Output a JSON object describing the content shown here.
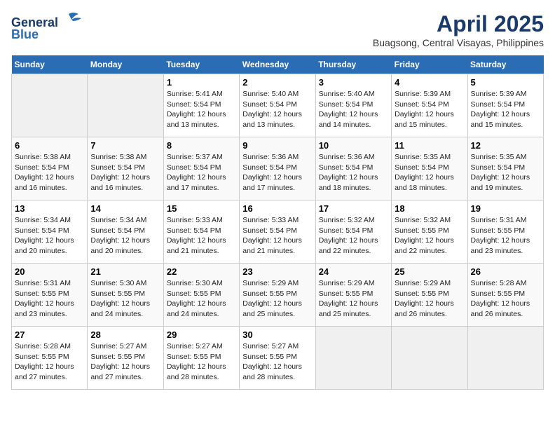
{
  "logo": {
    "line1": "General",
    "line2": "Blue"
  },
  "title": {
    "month_year": "April 2025",
    "location": "Buagsong, Central Visayas, Philippines"
  },
  "weekdays": [
    "Sunday",
    "Monday",
    "Tuesday",
    "Wednesday",
    "Thursday",
    "Friday",
    "Saturday"
  ],
  "weeks": [
    [
      {
        "day": "",
        "info": ""
      },
      {
        "day": "",
        "info": ""
      },
      {
        "day": "1",
        "info": "Sunrise: 5:41 AM\nSunset: 5:54 PM\nDaylight: 12 hours\nand 13 minutes."
      },
      {
        "day": "2",
        "info": "Sunrise: 5:40 AM\nSunset: 5:54 PM\nDaylight: 12 hours\nand 13 minutes."
      },
      {
        "day": "3",
        "info": "Sunrise: 5:40 AM\nSunset: 5:54 PM\nDaylight: 12 hours\nand 14 minutes."
      },
      {
        "day": "4",
        "info": "Sunrise: 5:39 AM\nSunset: 5:54 PM\nDaylight: 12 hours\nand 15 minutes."
      },
      {
        "day": "5",
        "info": "Sunrise: 5:39 AM\nSunset: 5:54 PM\nDaylight: 12 hours\nand 15 minutes."
      }
    ],
    [
      {
        "day": "6",
        "info": "Sunrise: 5:38 AM\nSunset: 5:54 PM\nDaylight: 12 hours\nand 16 minutes."
      },
      {
        "day": "7",
        "info": "Sunrise: 5:38 AM\nSunset: 5:54 PM\nDaylight: 12 hours\nand 16 minutes."
      },
      {
        "day": "8",
        "info": "Sunrise: 5:37 AM\nSunset: 5:54 PM\nDaylight: 12 hours\nand 17 minutes."
      },
      {
        "day": "9",
        "info": "Sunrise: 5:36 AM\nSunset: 5:54 PM\nDaylight: 12 hours\nand 17 minutes."
      },
      {
        "day": "10",
        "info": "Sunrise: 5:36 AM\nSunset: 5:54 PM\nDaylight: 12 hours\nand 18 minutes."
      },
      {
        "day": "11",
        "info": "Sunrise: 5:35 AM\nSunset: 5:54 PM\nDaylight: 12 hours\nand 18 minutes."
      },
      {
        "day": "12",
        "info": "Sunrise: 5:35 AM\nSunset: 5:54 PM\nDaylight: 12 hours\nand 19 minutes."
      }
    ],
    [
      {
        "day": "13",
        "info": "Sunrise: 5:34 AM\nSunset: 5:54 PM\nDaylight: 12 hours\nand 20 minutes."
      },
      {
        "day": "14",
        "info": "Sunrise: 5:34 AM\nSunset: 5:54 PM\nDaylight: 12 hours\nand 20 minutes."
      },
      {
        "day": "15",
        "info": "Sunrise: 5:33 AM\nSunset: 5:54 PM\nDaylight: 12 hours\nand 21 minutes."
      },
      {
        "day": "16",
        "info": "Sunrise: 5:33 AM\nSunset: 5:54 PM\nDaylight: 12 hours\nand 21 minutes."
      },
      {
        "day": "17",
        "info": "Sunrise: 5:32 AM\nSunset: 5:54 PM\nDaylight: 12 hours\nand 22 minutes."
      },
      {
        "day": "18",
        "info": "Sunrise: 5:32 AM\nSunset: 5:55 PM\nDaylight: 12 hours\nand 22 minutes."
      },
      {
        "day": "19",
        "info": "Sunrise: 5:31 AM\nSunset: 5:55 PM\nDaylight: 12 hours\nand 23 minutes."
      }
    ],
    [
      {
        "day": "20",
        "info": "Sunrise: 5:31 AM\nSunset: 5:55 PM\nDaylight: 12 hours\nand 23 minutes."
      },
      {
        "day": "21",
        "info": "Sunrise: 5:30 AM\nSunset: 5:55 PM\nDaylight: 12 hours\nand 24 minutes."
      },
      {
        "day": "22",
        "info": "Sunrise: 5:30 AM\nSunset: 5:55 PM\nDaylight: 12 hours\nand 24 minutes."
      },
      {
        "day": "23",
        "info": "Sunrise: 5:29 AM\nSunset: 5:55 PM\nDaylight: 12 hours\nand 25 minutes."
      },
      {
        "day": "24",
        "info": "Sunrise: 5:29 AM\nSunset: 5:55 PM\nDaylight: 12 hours\nand 25 minutes."
      },
      {
        "day": "25",
        "info": "Sunrise: 5:29 AM\nSunset: 5:55 PM\nDaylight: 12 hours\nand 26 minutes."
      },
      {
        "day": "26",
        "info": "Sunrise: 5:28 AM\nSunset: 5:55 PM\nDaylight: 12 hours\nand 26 minutes."
      }
    ],
    [
      {
        "day": "27",
        "info": "Sunrise: 5:28 AM\nSunset: 5:55 PM\nDaylight: 12 hours\nand 27 minutes."
      },
      {
        "day": "28",
        "info": "Sunrise: 5:27 AM\nSunset: 5:55 PM\nDaylight: 12 hours\nand 27 minutes."
      },
      {
        "day": "29",
        "info": "Sunrise: 5:27 AM\nSunset: 5:55 PM\nDaylight: 12 hours\nand 28 minutes."
      },
      {
        "day": "30",
        "info": "Sunrise: 5:27 AM\nSunset: 5:55 PM\nDaylight: 12 hours\nand 28 minutes."
      },
      {
        "day": "",
        "info": ""
      },
      {
        "day": "",
        "info": ""
      },
      {
        "day": "",
        "info": ""
      }
    ]
  ]
}
